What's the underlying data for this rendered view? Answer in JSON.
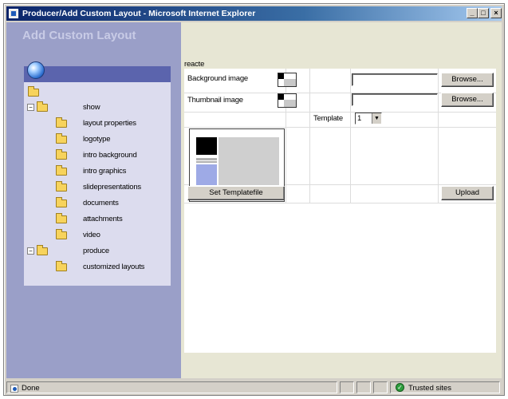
{
  "window": {
    "title": "Producer/Add Custom Layout - Microsoft Internet Explorer",
    "minimize_glyph": "_",
    "maximize_glyph": "□",
    "close_glyph": "×"
  },
  "page": {
    "heading": "Add Custom Layout"
  },
  "tree": {
    "show": {
      "expander": "−",
      "label": "show"
    },
    "show_children": [
      {
        "label": "layout properties"
      },
      {
        "label": "logotype"
      },
      {
        "label": "intro background"
      },
      {
        "label": "intro graphics"
      },
      {
        "label": "slidepresentations"
      },
      {
        "label": "documents"
      },
      {
        "label": "attachments"
      },
      {
        "label": "video"
      }
    ],
    "produce": {
      "expander": "−",
      "label": "produce"
    },
    "produce_children": [
      {
        "label": "customized layouts"
      }
    ]
  },
  "form": {
    "section_label": "reacte",
    "background_label": "Background image",
    "thumbnail_label": "Thumbnail image",
    "browse_label": "Browse...",
    "browse2_label": "Browse...",
    "template_label": "Template",
    "template_value": "1",
    "set_template_label": "Set Templatefile",
    "upload_label": "Upload"
  },
  "status": {
    "left_text": "Done",
    "zone_text": "Trusted sites",
    "zone_glyph": "✓"
  },
  "colors": {
    "titlebar_start": "#0a246a",
    "left_panel": "#9a9fc8",
    "tree_header": "#5b64ad",
    "preview_purple": "#9eaae6"
  }
}
